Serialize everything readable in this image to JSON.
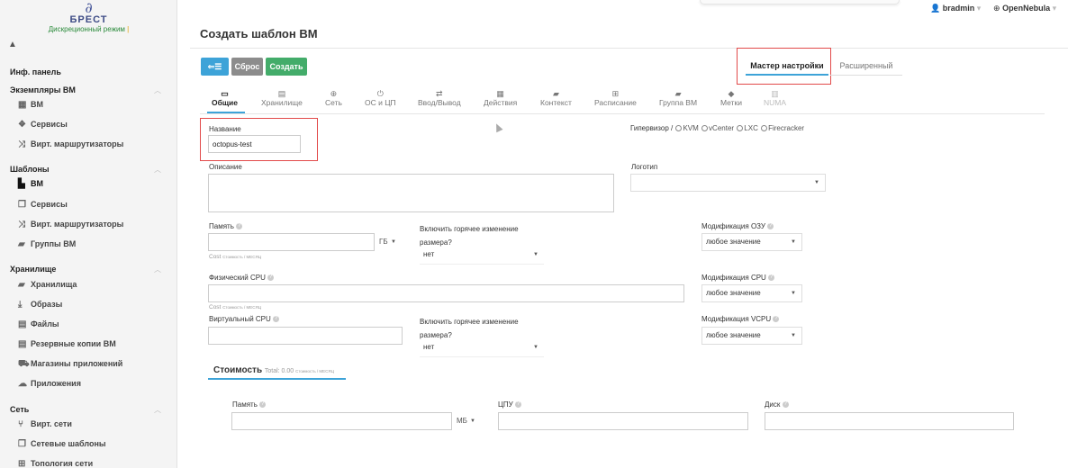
{
  "sidebar": {
    "logo": {
      "name": "БРЕСТ",
      "mode": "Дискреционный режим",
      "mode_marker": "|"
    },
    "collapse_symbol": "▲",
    "sections": {
      "dashboard": "Инф. панель",
      "instances": {
        "title": "Экземпляры ВМ",
        "items": [
          "ВМ",
          "Сервисы",
          "Вирт. маршрутизаторы"
        ]
      },
      "templates": {
        "title": "Шаблоны",
        "items": [
          "ВМ",
          "Сервисы",
          "Вирт. маршрутизаторы",
          "Группы ВМ"
        ]
      },
      "storage": {
        "title": "Хранилище",
        "items": [
          "Хранилища",
          "Образы",
          "Файлы",
          "Резервные копии ВМ",
          "Магазины приложений",
          "Приложения"
        ]
      },
      "network": {
        "title": "Сеть",
        "items": [
          "Вирт. сети",
          "Сетевые шаблоны",
          "Топология сети"
        ]
      }
    }
  },
  "topbar": {
    "user": "bradmin",
    "cloud": "OpenNebula"
  },
  "main": {
    "title": "Создать шаблон ВМ",
    "toolbar": {
      "back": "⇐☰",
      "reset": "Сброс",
      "create": "Создать"
    },
    "mode_tabs": {
      "wizard": "Мастер настройки",
      "advanced": "Расширенный"
    },
    "section_tabs": [
      "Общие",
      "Хранилище",
      "Сеть",
      "ОС и ЦП",
      "Ввод/Вывод",
      "Действия",
      "Контекст",
      "Расписание",
      "Группа ВМ",
      "Метки",
      "NUMA"
    ],
    "form": {
      "name_label": "Название",
      "name_value": "octopus-test",
      "hypervisor_label": "Гипервизор /",
      "hypervisors": [
        "KVM",
        "vCenter",
        "LXC",
        "Firecracker"
      ],
      "description_label": "Описание",
      "logo_label": "Логотип",
      "memory_label": "Память",
      "memory_unit": "ГБ",
      "cost_hint": "Cost",
      "cost_hint_small": "Стоимость / МЕСЯЦ",
      "hot_resize_label": "Включить горячее изменение размера?",
      "hot_resize_value": "нет",
      "ram_mod_label": "Модификация ОЗУ",
      "any_value": "любое значение",
      "physical_cpu_label": "Физический CPU",
      "cpu_mod_label": "Модификация CPU",
      "virtual_cpu_label": "Виртуальный CPU",
      "vcpu_mod_label": "Модификация VCPU"
    },
    "cost": {
      "title": "Стоимость",
      "total": "Total: 0.00",
      "total_small": "Стоимость / МЕСЯЦ",
      "memory_label": "Память",
      "memory_unit": "МБ",
      "cpu_label": "ЦПУ",
      "disk_label": "Диск"
    }
  }
}
